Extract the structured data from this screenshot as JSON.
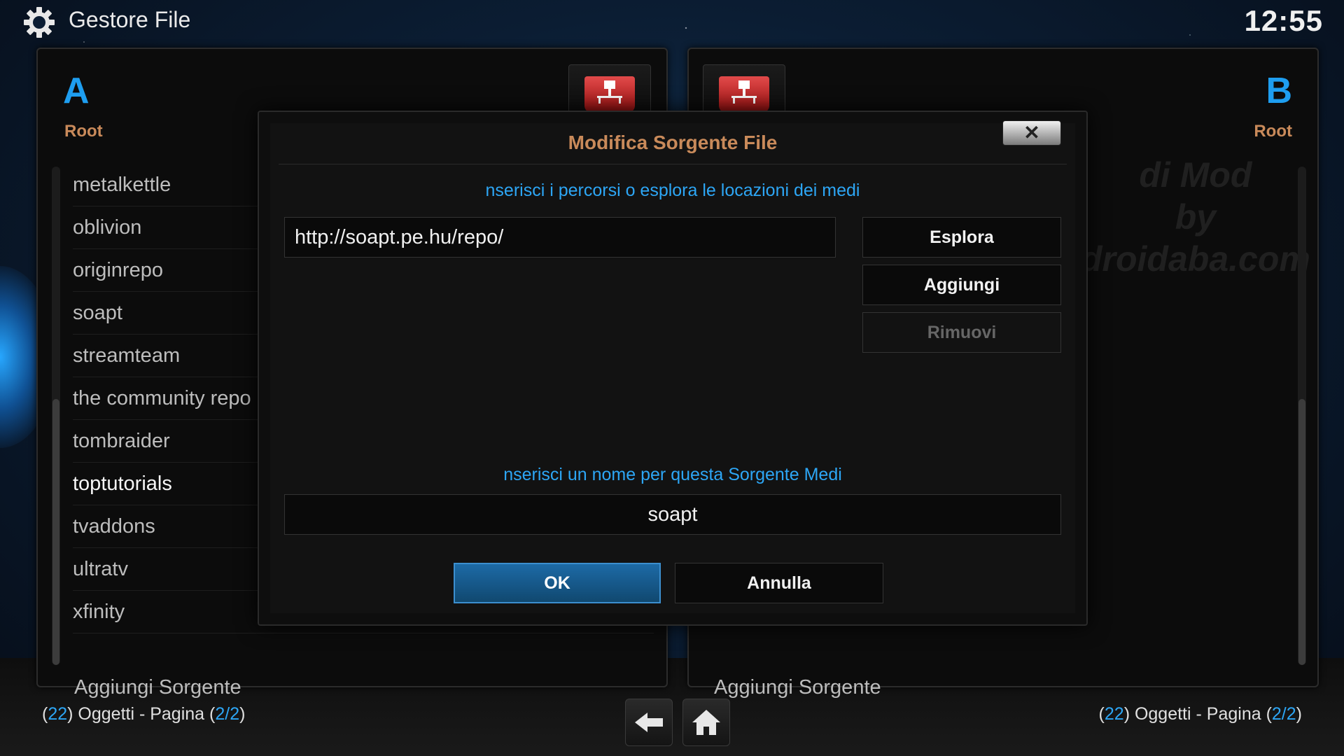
{
  "header": {
    "title": "Gestore File",
    "clock": "12:55",
    "icon": "gear-icon"
  },
  "panel_a": {
    "letter": "A",
    "path": "Root",
    "items": [
      "metalkettle",
      "oblivion",
      "originrepo",
      "soapt",
      "streamteam",
      "the community repo",
      "tombraider",
      "toptutorials",
      "tvaddons",
      "ultratv",
      "xfinity"
    ],
    "add_source": "Aggiungi Sorgente"
  },
  "panel_b": {
    "letter": "B",
    "path": "Root",
    "watermark": [
      "di Mod",
      "by",
      "droidaba.com"
    ],
    "add_source": "Aggiungi Sorgente"
  },
  "footer": {
    "left": {
      "open1": "(",
      "count": "22",
      "text": ") Oggetti - Pagina (",
      "page": "2/2",
      "close": ")"
    },
    "right": {
      "open1": "(",
      "count": "22",
      "text": ") Oggetti - Pagina (",
      "page": "2/2",
      "close": ")"
    }
  },
  "dialog": {
    "title": "Modifica Sorgente File",
    "close_label": "✕",
    "path_prompt": "nserisci i percorsi o esplora le locazioni dei medi",
    "path_value": "http://soapt.pe.hu/repo/",
    "buttons": {
      "browse": "Esplora",
      "add": "Aggiungi",
      "remove": "Rimuovi"
    },
    "name_prompt": "nserisci un nome per questa Sorgente Medi",
    "name_value": "soapt",
    "ok": "OK",
    "cancel": "Annulla"
  },
  "colors": {
    "accent": "#2da6f5",
    "title_bronze": "#c98a5a",
    "ok_blue": "#1d6aa6",
    "drive_red": "#d43030"
  }
}
